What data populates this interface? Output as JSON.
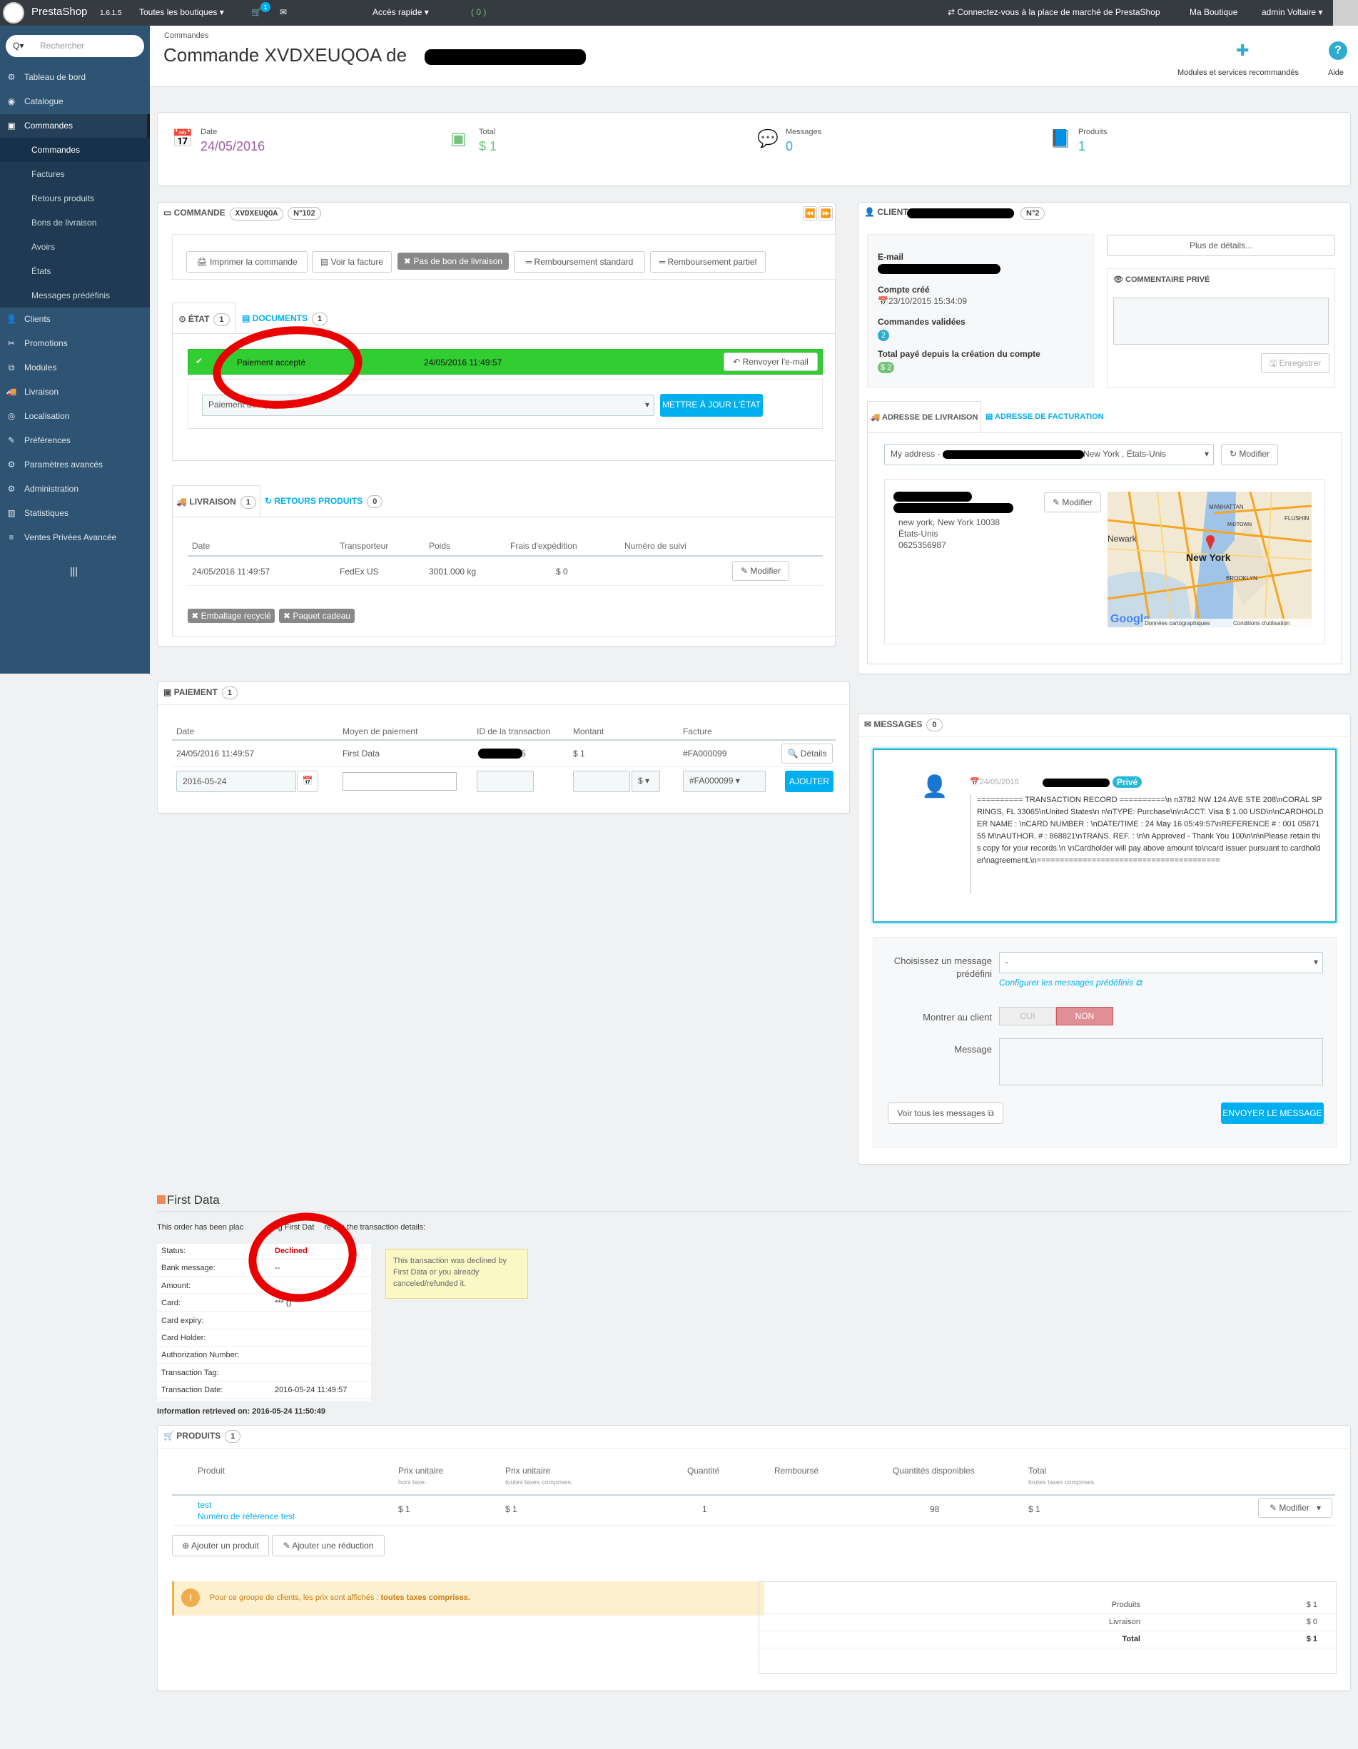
{
  "topbar": {
    "brand": "PrestaShop",
    "version": "1.6.1.5",
    "shops": "Toutes les boutiques ▾",
    "cart_count": "1",
    "quick_access": "Accès rapide ▾",
    "notif": "( 0 )",
    "connect": "Connectez-vous à la place de marché de PrestaShop",
    "my_shop": "Ma Boutique",
    "user": "admin Voltaire ▾"
  },
  "sidebar": {
    "search_placeholder": "Rechercher",
    "items": [
      {
        "label": "Tableau de bord",
        "icon": "dashboard-icon"
      },
      {
        "label": "Catalogue",
        "icon": "catalog-icon"
      },
      {
        "label": "Commandes",
        "icon": "orders-icon"
      }
    ],
    "sub_items": [
      "Commandes",
      "Factures",
      "Retours produits",
      "Bons de livraison",
      "Avoirs",
      "États",
      "Messages prédéfinis"
    ],
    "items2": [
      {
        "label": "Clients"
      },
      {
        "label": "Promotions"
      },
      {
        "label": "Modules"
      },
      {
        "label": "Livraison"
      },
      {
        "label": "Localisation"
      },
      {
        "label": "Préférences"
      },
      {
        "label": "Paramètres avancés"
      },
      {
        "label": "Administration"
      },
      {
        "label": "Statistiques"
      },
      {
        "label": "Ventes Privées Avancée"
      }
    ]
  },
  "header": {
    "breadcrumb": "Commandes",
    "title": "Commande XVDXEUQOA de",
    "modules_label": "Modules et services recommandés",
    "help_label": "Aide"
  },
  "kpis": [
    {
      "label": "Date",
      "value": "24/05/2016",
      "color": "#9e5ba1"
    },
    {
      "label": "Total",
      "value": "$ 1",
      "color": "#72c279"
    },
    {
      "label": "Messages",
      "value": "0",
      "color": "#2eacce"
    },
    {
      "label": "Produits",
      "value": "1",
      "color": "#2eacce"
    }
  ],
  "order": {
    "header_label": "COMMANDE",
    "ref": "XVDXEUQOA",
    "number": "N°102",
    "buttons": [
      "Imprimer la commande",
      "Voir la facture",
      "Pas de bon de livraison",
      "Remboursement standard",
      "Remboursement partiel"
    ],
    "tab_state": "ÉTAT",
    "tab_state_count": "1",
    "tab_docs": "DOCUMENTS",
    "tab_docs_count": "1",
    "status": "Paiement accepté",
    "status_date": "24/05/2016 11:49:57",
    "resend": "Renvoyer l'e-mail",
    "select_value": "Paiement accepté",
    "update_btn": "METTRE À JOUR L'ÉTAT"
  },
  "shipping": {
    "tab": "LIVRAISON",
    "tab_count": "1",
    "returns_tab": "RETOURS PRODUITS",
    "returns_count": "0",
    "columns": [
      "Date",
      "Transporteur",
      "Poids",
      "Frais d'expédition",
      "Numéro de suivi"
    ],
    "row": [
      "24/05/2016 11:49:57",
      "FedEx US",
      "3001.000 kg",
      "$ 0"
    ],
    "edit": "Modifier",
    "tags": [
      "Emballage recyclé",
      "Paquet cadeau"
    ]
  },
  "payment": {
    "header": "PAIEMENT",
    "count": "1",
    "columns": [
      "Date",
      "Moyen de paiement",
      "ID de la transaction",
      "Montant",
      "Facture"
    ],
    "row": [
      "24/05/2016 11:49:57",
      "First Data",
      "5",
      "$ 1",
      "#FA000099"
    ],
    "details": "Détails",
    "new_date": "2016-05-24",
    "currency": "$",
    "invoice": "#FA000099",
    "add": "AJOUTER"
  },
  "client": {
    "header": "CLIENT",
    "number": "N°2",
    "more": "Plus de détails...",
    "email_label": "E-mail",
    "created_label": "Compte créé",
    "created_value": "23/10/2015 15:34:09",
    "orders_label": "Commandes validées",
    "orders_value": "2",
    "paid_label": "Total payé depuis la création du compte",
    "paid_value": "$ 2",
    "private_note": "COMMENTAIRE PRIVÉ",
    "save": "Enregistrer",
    "tab_shipping": "ADRESSE DE LIVRAISON",
    "tab_billing": "ADRESSE DE FACTURATION",
    "address_select": "My address -",
    "address_select_tail": "New York , États-Unis",
    "edit": "Modifier",
    "addr_lines": [
      "new york, New York 10038",
      "États-Unis",
      "0625356987"
    ],
    "map": {
      "city": "New York",
      "labels": [
        "Newark",
        "MANHATTAN",
        "BROOKLYN",
        "MIDTOWN",
        "FLUSHIN"
      ],
      "data": "Données cartographiques",
      "terms": "Conditions d'utilisation",
      "google": "Google"
    }
  },
  "messages": {
    "header": "MESSAGES",
    "count": "0",
    "date": "24/05/2016",
    "priv": "Privé",
    "body": "========== TRANSACTION RECORD ==========\\n n3782 NW 124 AVE STE 208\\nCORAL SPRINGS, FL 33065\\nUnited States\\n n\\nTYPE: Purchase\\n\\nACCT: Visa $ 1.00 USD\\n\\nCARDHOLDER NAME : \\nCARD NUMBER : \\nDATE/TIME : 24 May 16 05:49:57\\nREFERENCE # : 001 0587155 M\\nAUTHOR. # : 868821\\nTRANS. REF. : \\n\\n Approved - Thank You 100\\n\\n\\nPlease retain this copy for your records.\\n \\nCardholder will pay above amount to\\ncard issuer pursuant to cardholder\\nagreement.\\n========================================",
    "choose_label_1": "Choisissez un message",
    "choose_label_2": "prédéfini",
    "choose_value": "-",
    "configure": "Configurer les messages prédéfinis",
    "show_label": "Montrer au client",
    "oui": "OUI",
    "non": "NON",
    "message_label": "Message",
    "view_all": "Voir tous les messages",
    "send": "ENVOYER LE MESSAGE"
  },
  "firstdata": {
    "title": "First Data",
    "intro_a": "This order has been plac",
    "intro_b": "ing First Dat",
    "intro_c": "re are the transaction details:",
    "rows": [
      {
        "k": "Status:",
        "v": "Declined"
      },
      {
        "k": "Bank message:",
        "v": "--"
      },
      {
        "k": "Amount:",
        "v": ""
      },
      {
        "k": "Card:",
        "v": "*** ()"
      },
      {
        "k": "Card expiry:",
        "v": ""
      },
      {
        "k": "Card Holder:",
        "v": ""
      },
      {
        "k": "Authorization Number:",
        "v": ""
      },
      {
        "k": "Transaction Tag:",
        "v": ""
      },
      {
        "k": "Transaction Date:",
        "v": "2016-05-24 11:49:57"
      }
    ],
    "notice": "This transaction was declined by First Data or you already canceled/refunded it.",
    "retrieved": "Information retrieved on: 2016-05-24 11:50:49"
  },
  "products": {
    "header": "PRODUITS",
    "count": "1",
    "columns": [
      {
        "t": "Produit",
        "s": ""
      },
      {
        "t": "Prix unitaire",
        "s": "hors taxe."
      },
      {
        "t": "Prix unitaire",
        "s": "toutes taxes comprises."
      },
      {
        "t": "Quantité",
        "s": ""
      },
      {
        "t": "Remboursé",
        "s": ""
      },
      {
        "t": "Quantités disponibles",
        "s": ""
      },
      {
        "t": "Total",
        "s": "toutes taxes comprises."
      }
    ],
    "row": {
      "name": "test",
      "ref": "Numéro de référence test",
      "pu_ht": "$ 1",
      "pu_ttc": "$ 1",
      "qty": "1",
      "stock": "98",
      "total": "$ 1"
    },
    "edit": "Modifier",
    "add_product": "Ajouter un produit",
    "add_discount": "Ajouter une réduction",
    "warning_a": "Pour ce groupe de clients, les prix sont affichés :",
    "warning_b": "toutes taxes comprises.",
    "totals": [
      {
        "k": "Produits",
        "v": "$ 1"
      },
      {
        "k": "Livraison",
        "v": "$ 0"
      },
      {
        "k": "Total",
        "v": "$ 1"
      }
    ]
  },
  "colors": {
    "accent": "#00aff0",
    "sidebar": "#2f5372",
    "topbar": "#363a41",
    "status_green": "#32cd32",
    "declined": "#e00000"
  }
}
